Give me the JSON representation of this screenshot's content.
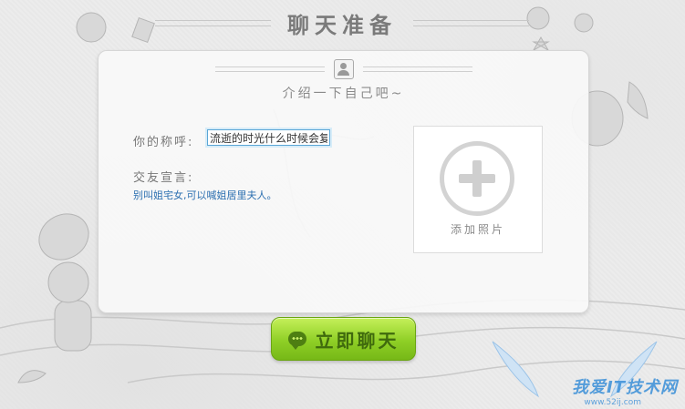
{
  "window": {
    "title": "聊天准备"
  },
  "panel": {
    "intro": "介绍一下自己吧~",
    "nickname_label": "你的称呼:",
    "nickname_value": "流逝的时光什么时候会复",
    "motto_label": "交友宣言:",
    "motto_text": "别叫姐宅女,可以喊姐居里夫人。",
    "add_photo_label": "添加照片"
  },
  "actions": {
    "start_chat_label": "立即聊天"
  },
  "watermark": {
    "text": "我爱IT技术网",
    "sub": "www.52ij.com"
  },
  "colors": {
    "accent_green": "#8fcf26",
    "link_blue": "#2b6fb0",
    "input_border": "#5aa6d6"
  },
  "icons": [
    "avatar-icon",
    "plus-icon",
    "chat-bubble-icon"
  ]
}
